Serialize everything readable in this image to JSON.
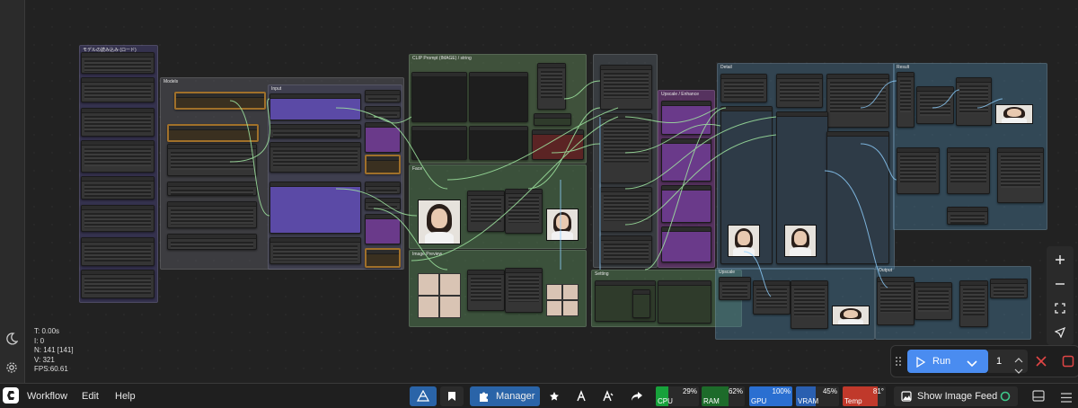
{
  "stats": {
    "t": "T: 0.00s",
    "i": "I: 0",
    "n": "N: 141 [141]",
    "v": "V: 321",
    "fps": "FPS:60.61"
  },
  "groups": {
    "g1": "モデルの読み込み (ロード)",
    "g2": "Models",
    "g3": "Input",
    "g4": "CLIP Prompt (IMAGE) / string",
    "g5": "Upscale / Enhance",
    "g6": "Face",
    "g7": "Output",
    "g8": "Image Preview",
    "g9": "Image Preview",
    "g10": "Setting",
    "g11": "Detail",
    "g12": "Result",
    "g13": "Upscale"
  },
  "run": {
    "label": "Run",
    "count": "1"
  },
  "menu": {
    "workflow": "Workflow",
    "edit": "Edit",
    "help": "Help",
    "manager": "Manager",
    "show_feed": "Show Image Feed"
  },
  "monitors": {
    "cpu": {
      "name": "CPU",
      "value": "29%",
      "pct": 29,
      "color": "#17a23b"
    },
    "ram": {
      "name": "RAM",
      "value": "62%",
      "pct": 62,
      "color": "#1d6b2a"
    },
    "gpu": {
      "name": "GPU",
      "value": "100%",
      "pct": 100,
      "color": "#2a6fd1"
    },
    "vram": {
      "name": "VRAM",
      "value": "45%",
      "pct": 45,
      "color": "#2a5fb0"
    },
    "temp": {
      "name": "Temp",
      "value": "81°",
      "pct": 81,
      "color": "#c0392b"
    }
  },
  "colors": {
    "accent": "#4a8cf0",
    "manager": "#2a64a8",
    "wire": "#9fe6a0",
    "wire_blue": "#8fd0ff"
  }
}
